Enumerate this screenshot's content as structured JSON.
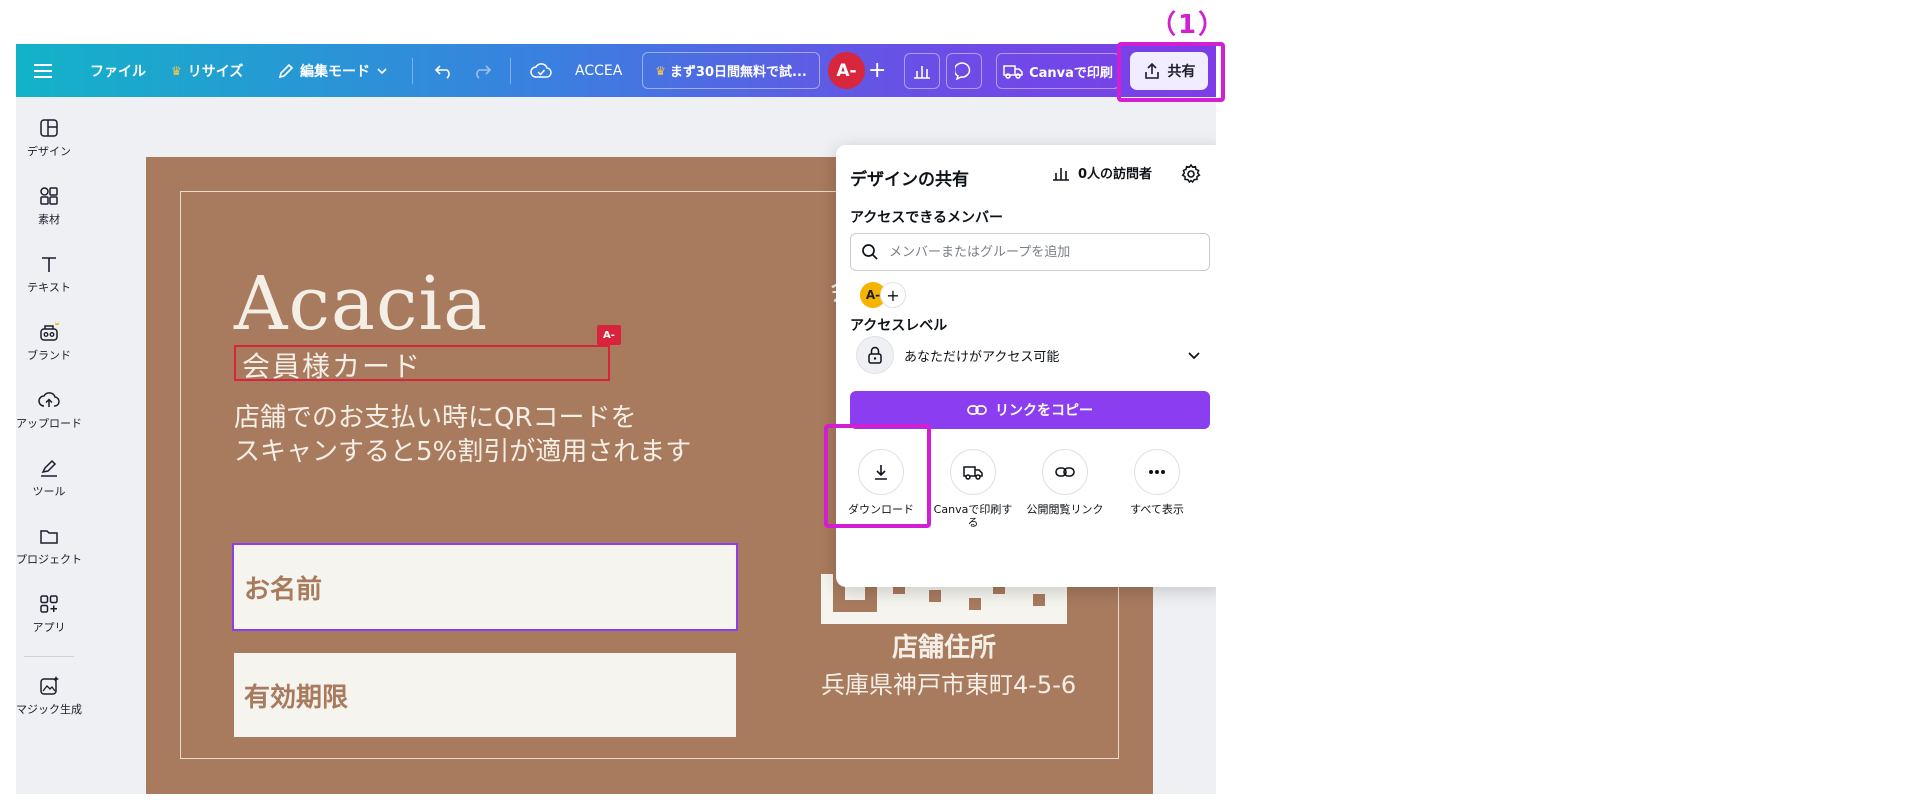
{
  "annotation": {
    "label": "（1）"
  },
  "topbar": {
    "file": "ファイル",
    "resize": "リサイズ",
    "edit_mode": "編集モード",
    "doc_name": "ACCEA",
    "trial": "まず30日間無料で試...",
    "avatar": "A-",
    "print": "Canvaで印刷",
    "share": "共有"
  },
  "sidebar": {
    "items": [
      {
        "label": "デザイン"
      },
      {
        "label": "素材"
      },
      {
        "label": "テキスト"
      },
      {
        "label": "ブランド"
      },
      {
        "label": "アップロード"
      },
      {
        "label": "ツール"
      },
      {
        "label": "プロジェクト"
      },
      {
        "label": "アプリ"
      },
      {
        "label": "マジック生成"
      }
    ]
  },
  "card": {
    "title": "Acacia",
    "subtitle": "会員様カード",
    "tag": "A-",
    "desc_line1": "店舗でのお支払い時にQRコードを",
    "desc_line2": "スキャンすると5%割引が適用されます",
    "field_name": "お名前",
    "field_expiry": "有効期限",
    "ghost_char": "会",
    "addr_title": "店舗住所",
    "addr_line": "兵庫県神戸市東町4-5-6"
  },
  "share_popup": {
    "title": "デザインの共有",
    "visitors": "0人の訪問者",
    "members_label": "アクセスできるメンバー",
    "search_placeholder": "メンバーまたはグループを追加",
    "member_avatar": "A-",
    "access_level_label": "アクセスレベル",
    "access_level_value": "あなただけがアクセス可能",
    "copy_link": "リンクをコピー",
    "options": [
      {
        "label": "ダウンロード"
      },
      {
        "label": "Canvaで印刷する"
      },
      {
        "label": "公開閲覧リンク"
      },
      {
        "label": "すべて表示"
      }
    ]
  },
  "colors": {
    "accent": "#8b3df0",
    "annotation": "#d21fd2",
    "card_bg": "#a87a5e",
    "avatar_red": "#d8263c"
  }
}
